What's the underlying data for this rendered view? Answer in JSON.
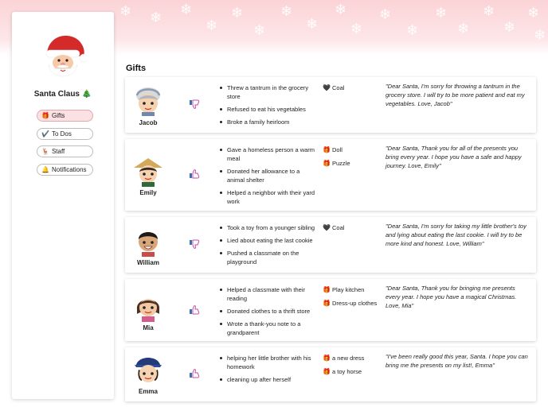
{
  "sidebar": {
    "user_name": "Santa Claus 🎄",
    "nav": [
      {
        "icon": "🎁",
        "label": "Gifts",
        "active": true
      },
      {
        "icon": "✔️",
        "label": "To Dos",
        "active": false
      },
      {
        "icon": "🦌",
        "label": "Staff",
        "active": false
      },
      {
        "icon": "🔔",
        "label": "Notifications",
        "active": false
      }
    ]
  },
  "main": {
    "heading": "Gifts",
    "children": [
      {
        "name": "Jacob",
        "verdict": "naughty",
        "deeds": [
          "Threw a tantrum in the grocery store",
          "Refused to eat his vegetables",
          "Broke a family heirloom"
        ],
        "gifts": [
          {
            "icon": "🖤",
            "label": "Coal"
          }
        ],
        "letter": "\"Dear Santa, I'm sorry for throwing a tantrum in the grocery store. I will try to be more patient and eat my vegetables. Love, Jacob\""
      },
      {
        "name": "Emily",
        "verdict": "nice",
        "deeds": [
          "Gave a homeless person a warm meal",
          "Donated her allowance to a animal shelter",
          "Helped a neighbor with their yard work"
        ],
        "gifts": [
          {
            "icon": "🎁",
            "label": "Doll"
          },
          {
            "icon": "🎁",
            "label": "Puzzle"
          }
        ],
        "letter": "\"Dear Santa, Thank you for all of the presents you bring every year. I hope you have a safe and happy journey. Love, Emily\""
      },
      {
        "name": "William",
        "verdict": "naughty",
        "deeds": [
          "Took a toy from a younger sibling",
          "Lied about eating the last cookie",
          "Pushed a classmate on the playground"
        ],
        "gifts": [
          {
            "icon": "🖤",
            "label": "Coal"
          }
        ],
        "letter": "\"Dear Santa, I'm sorry for taking my little brother's toy and lying about eating the last cookie. I will try to be more kind and honest. Love, William\""
      },
      {
        "name": "Mia",
        "verdict": "nice",
        "deeds": [
          "Helped a classmate with their reading",
          "Donated clothes to a thrift store",
          "Wrote a thank-you note to a grandparent"
        ],
        "gifts": [
          {
            "icon": "🎁",
            "label": "Play kitchen"
          },
          {
            "icon": "🎁",
            "label": "Dress-up clothes"
          }
        ],
        "letter": "\"Dear Santa, Thank you for bringing me presents every year. I hope you have a magical Christmas. Love, Mia\""
      },
      {
        "name": "Emma",
        "verdict": "nice",
        "deeds": [
          "helping her little brother with his homework",
          "cleaning up after herself"
        ],
        "gifts": [
          {
            "icon": "🎁",
            "label": "a new dress"
          },
          {
            "icon": "🎁",
            "label": "a toy horse"
          }
        ],
        "letter": "\"I've been really good this year, Santa. I hope you can bring me the presents on my list!, Emma\""
      }
    ]
  },
  "colors": {
    "banner": "#fbd3d6",
    "active_nav": "#fbe1e3",
    "santa_red": "#d42a2a",
    "thumb_up": "#c94ca0",
    "thumb_down": "#3b6fb8"
  }
}
